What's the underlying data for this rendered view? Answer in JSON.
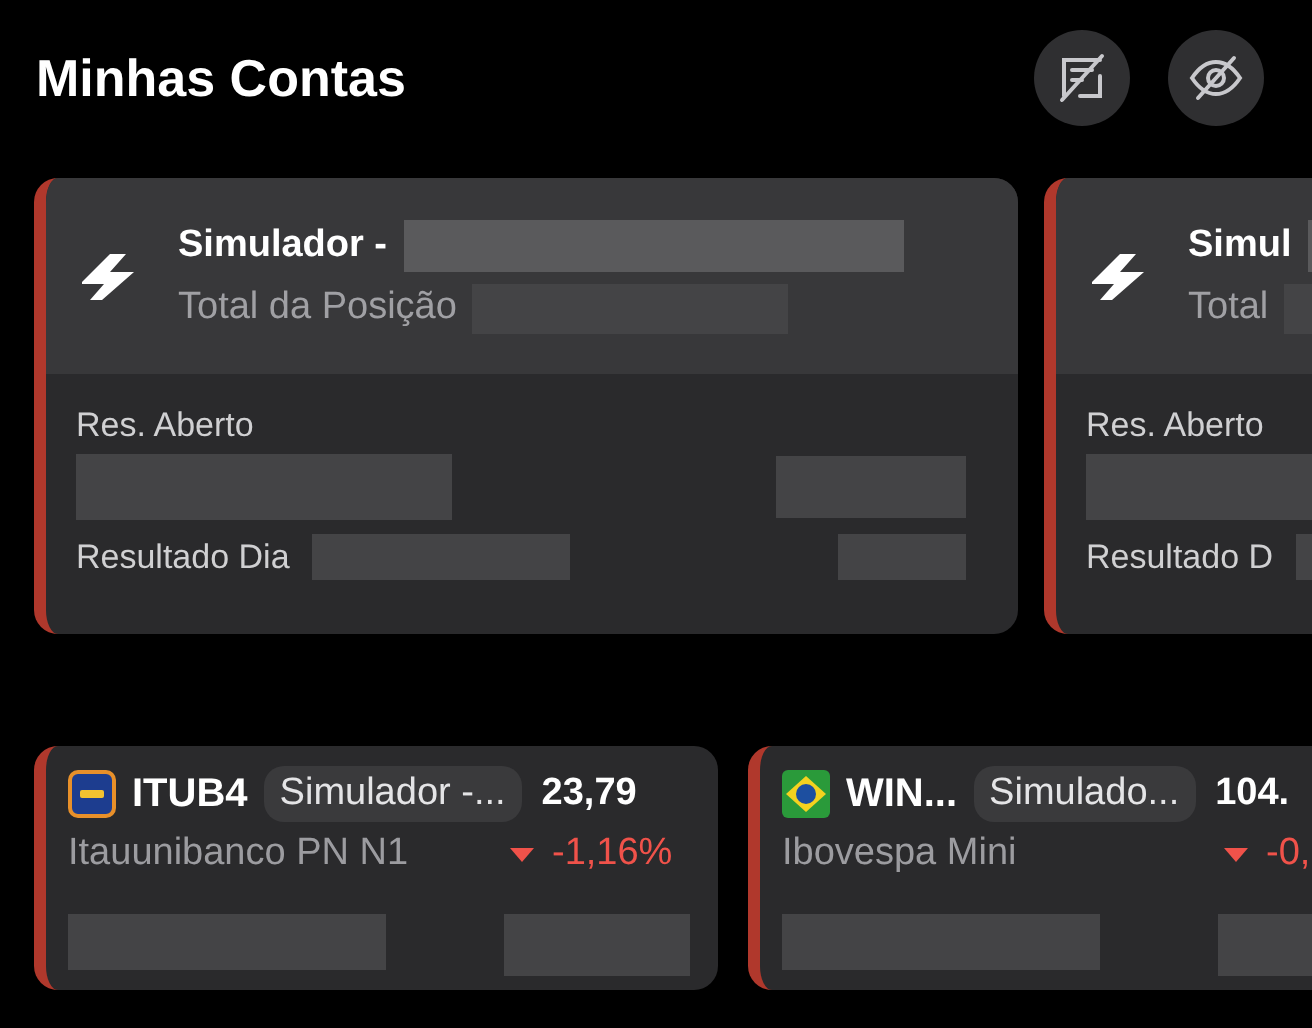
{
  "header": {
    "title": "Minhas Contas"
  },
  "accounts": [
    {
      "name": "Simulador -",
      "total_label": "Total da Posição",
      "open_result_label": "Res. Aberto",
      "day_result_label": "Resultado Dia"
    },
    {
      "name": "Simul",
      "total_label": "Total",
      "open_result_label": "Res. Aberto",
      "day_result_label": "Resultado D"
    }
  ],
  "quotes": [
    {
      "kind": "stock",
      "ticker": "ITUB4",
      "account": "Simulador -...",
      "price": "23,79",
      "name": "Itauunibanco PN N1",
      "change": "-1,16%",
      "falling": true
    },
    {
      "kind": "index",
      "ticker": "WIN...",
      "account": "Simulado...",
      "price": "104.",
      "name": "Ibovespa Mini",
      "change": "-0,",
      "falling": true
    }
  ]
}
